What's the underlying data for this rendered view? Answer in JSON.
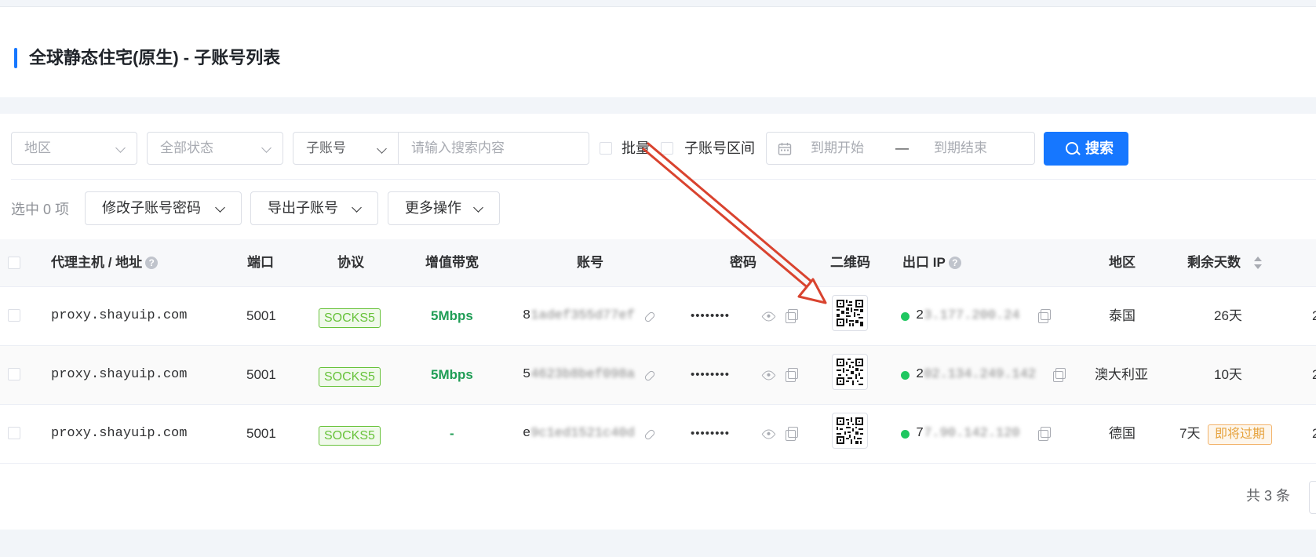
{
  "header": {
    "title": "全球静态住宅(原生) - 子账号列表"
  },
  "filters": {
    "region_placeholder": "地区",
    "status_placeholder": "全部状态",
    "field_selector": "子账号",
    "search_placeholder": "请输入搜索内容",
    "batch_label": "批量",
    "range_label": "子账号区间",
    "date_start_placeholder": "到期开始",
    "date_separator": "—",
    "date_end_placeholder": "到期结束",
    "search_button": "搜索"
  },
  "actions": {
    "selected_count": "选中 0 项",
    "change_password": "修改子账号密码",
    "export": "导出子账号",
    "more": "更多操作"
  },
  "table": {
    "columns": {
      "host": "代理主机 / 地址",
      "port": "端口",
      "protocol": "协议",
      "bandwidth": "增值带宽",
      "account": "账号",
      "password": "密码",
      "qrcode": "二维码",
      "exit_ip": "出口 IP",
      "region": "地区",
      "days_left": "剩余天数"
    },
    "rows": [
      {
        "host": "proxy.shayuip.com",
        "port": "5001",
        "protocol": "SOCKS5",
        "bandwidth": "5Mbps",
        "account_visible": "8",
        "account_blurred": "1adef355d77ef",
        "password": "••••••••",
        "ip_visible": "2",
        "ip_blurred": "3.177.200.24",
        "region": "泰国",
        "days": "26天",
        "warning": ""
      },
      {
        "host": "proxy.shayuip.com",
        "port": "5001",
        "protocol": "SOCKS5",
        "bandwidth": "5Mbps",
        "account_visible": "5",
        "account_blurred": "4623b8bef098a",
        "password": "••••••••",
        "ip_visible": "2",
        "ip_blurred": "02.134.249.142",
        "region": "澳大利亚",
        "days": "10天",
        "warning": ""
      },
      {
        "host": "proxy.shayuip.com",
        "port": "5001",
        "protocol": "SOCKS5",
        "bandwidth": "-",
        "account_visible": "e",
        "account_blurred": "9c1ed1521c40d",
        "password": "••••••••",
        "ip_visible": "7",
        "ip_blurred": "7.90.142.120",
        "region": "德国",
        "days": "7天",
        "warning": "即将过期"
      }
    ]
  },
  "footer": {
    "total": "共 3 条"
  },
  "colors": {
    "primary": "#1677ff",
    "success": "#67c23a",
    "warning": "#e6a23c",
    "annotation_arrow": "#d9432f"
  }
}
